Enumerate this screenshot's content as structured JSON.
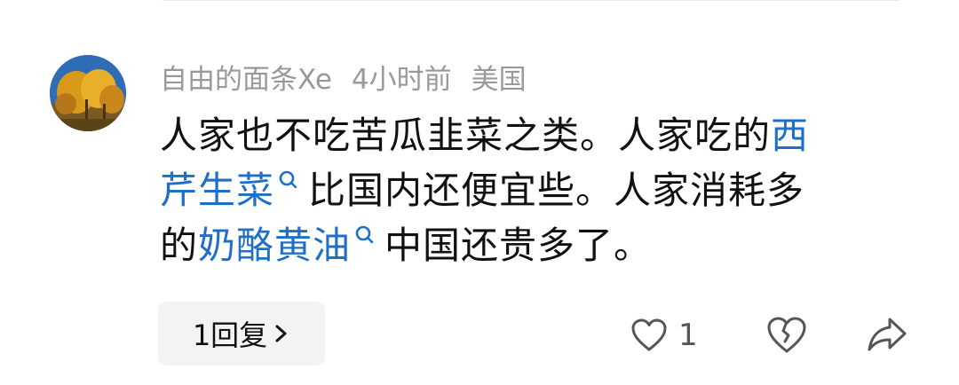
{
  "comment": {
    "author": "自由的面条Xe",
    "time": "4小时前",
    "location": "美国",
    "body": {
      "line1_text": "人家也不吃苦瓜韭菜之类。人家吃的",
      "line1_link": "西",
      "line2_link": "芹生菜",
      "line2_text": "比国内还便宜些。人家消耗多",
      "line3_text_a": "的",
      "line3_link": "奶酪黄油",
      "line3_text_b": "中国还贵多了。"
    },
    "reply_label": "1回复",
    "like_count": "1"
  },
  "colors": {
    "text": "#111111",
    "meta": "#999999",
    "link": "#1f6fc8",
    "reply_bg": "#f3f3f3"
  },
  "icons": [
    "avatar-image",
    "search-icon",
    "chevron-right-icon",
    "heart-icon",
    "broken-heart-icon",
    "share-icon"
  ]
}
